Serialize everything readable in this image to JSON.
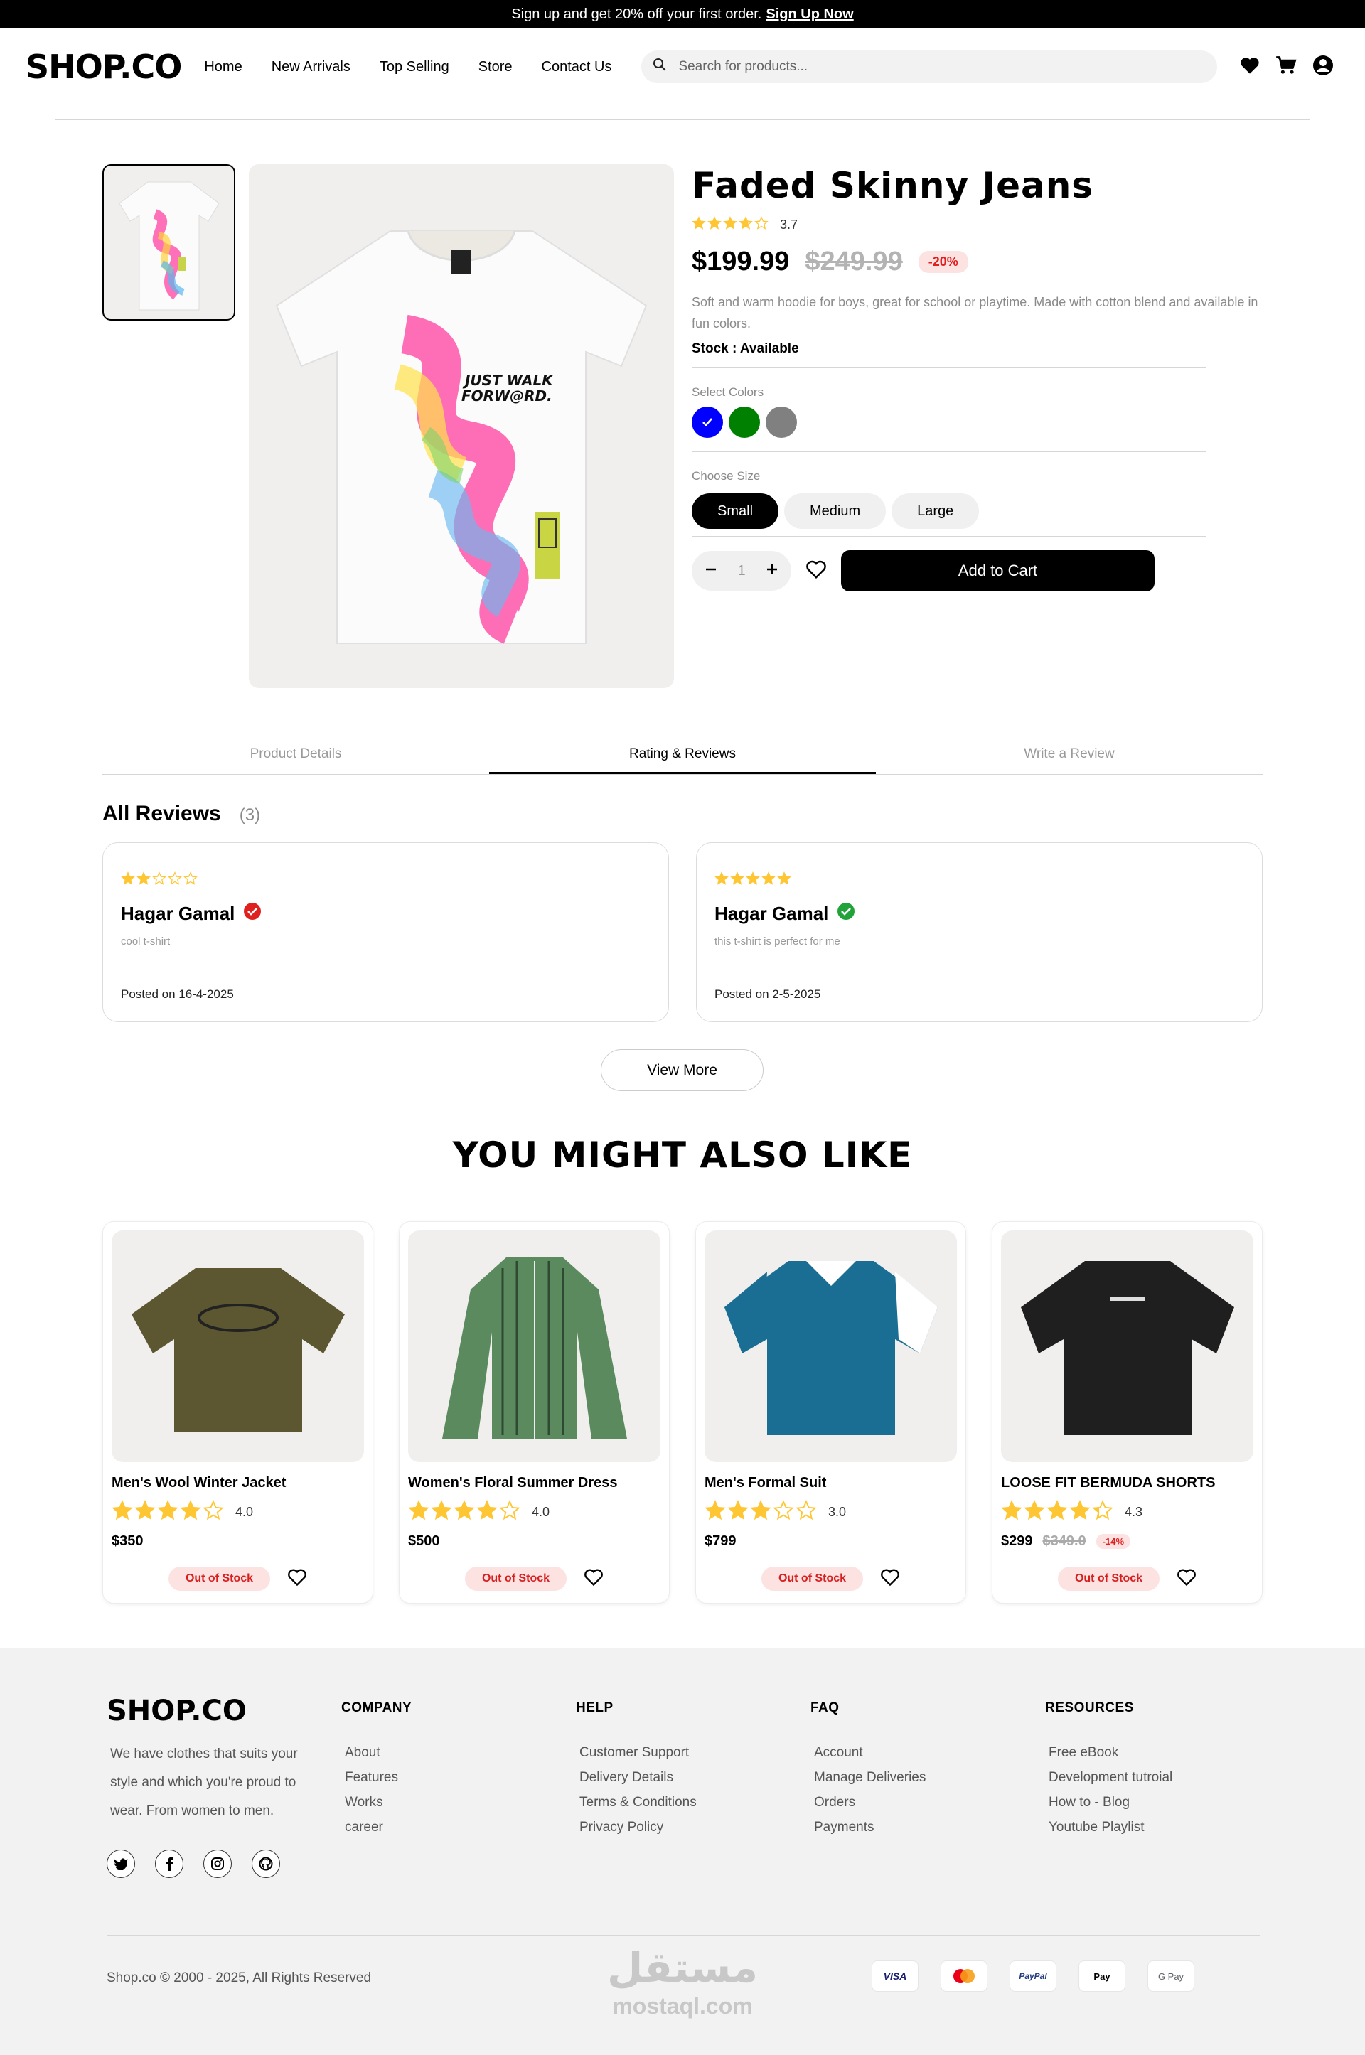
{
  "banner": {
    "text": "Sign up and get 20% off your first order.",
    "link": "Sign Up Now"
  },
  "nav": {
    "logo": "SHOP.CO",
    "links": [
      "Home",
      "New Arrivals",
      "Top Selling",
      "Store",
      "Contact Us"
    ],
    "search_placeholder": "Search for products..."
  },
  "product": {
    "title": "Faded Skinny Jeans",
    "rating": "3.7",
    "rating_value": 3.7,
    "price": "$199.99",
    "old_price": "$249.99",
    "discount": "-20%",
    "description": "Soft and warm hoodie for boys, great for school or playtime. Made with cotton blend and available in fun colors.",
    "stock": "Stock : Available",
    "colors_label": "Select Colors",
    "colors": [
      "#0000ff",
      "#008000",
      "#808080"
    ],
    "size_label": "Choose Size",
    "sizes": [
      "Small",
      "Medium",
      "Large"
    ],
    "quantity": "1",
    "add_to_cart": "Add to Cart",
    "print_text": "JUST WALK FORW@RD."
  },
  "tabs": [
    "Product Details",
    "Rating & Reviews",
    "Write a Review"
  ],
  "reviews": {
    "title": "All Reviews",
    "count": "(3)",
    "items": [
      {
        "rating": 2,
        "name": "Hagar Gamal",
        "text": "cool t-shirt",
        "date": "Posted on 16-4-2025",
        "verified_color": "#e01f1f"
      },
      {
        "rating": 5,
        "name": "Hagar Gamal",
        "text": "this t-shirt is perfect for me",
        "date": "Posted on 2-5-2025",
        "verified_color": "#22a33a"
      }
    ],
    "view_more": "View More"
  },
  "also_like": {
    "title": "YOU MIGHT ALSO LIKE",
    "items": [
      {
        "name": "Men's Wool Winter Jacket",
        "rating": "4.0",
        "rating_value": 4.0,
        "price": "$350",
        "status": "Out of Stock",
        "color": "#5c5631"
      },
      {
        "name": "Women's Floral Summer Dress",
        "rating": "4.0",
        "rating_value": 4.0,
        "price": "$500",
        "status": "Out of Stock",
        "color": "#5a8a5e"
      },
      {
        "name": "Men's Formal Suit",
        "rating": "3.0",
        "rating_value": 3.0,
        "price": "$799",
        "status": "Out of Stock",
        "color": "#1a6e93"
      },
      {
        "name": "LOOSE FIT BERMUDA SHORTS",
        "rating": "4.3",
        "rating_value": 4.3,
        "price": "$299",
        "old_price": "$349.0",
        "discount": "-14%",
        "status": "Out of Stock",
        "color": "#1f1f1f"
      }
    ]
  },
  "footer": {
    "logo": "SHOP.CO",
    "about": "We have clothes that suits your style and which you're proud to wear. From women to men.",
    "columns": [
      {
        "title": "COMPANY",
        "links": [
          "About",
          "Features",
          "Works",
          "career"
        ]
      },
      {
        "title": "HELP",
        "links": [
          "Customer Support",
          "Delivery Details",
          "Terms & Conditions",
          "Privacy Policy"
        ]
      },
      {
        "title": "FAQ",
        "links": [
          "Account",
          "Manage Deliveries",
          "Orders",
          "Payments"
        ]
      },
      {
        "title": "RESOURCES",
        "links": [
          "Free eBook",
          "Development tutroial",
          "How to - Blog",
          "Youtube Playlist"
        ]
      }
    ],
    "copyright": "Shop.co © 2000 - 2025, All Rights Reserved",
    "payments": [
      "VISA",
      "Mastercard",
      "PayPal",
      "Apple Pay",
      "G Pay"
    ],
    "watermark_ar": "مستقل",
    "watermark_en": "mostaql.com"
  },
  "colors": {
    "accent": "#000000",
    "star": "#ffc633",
    "danger": "#e01f1f",
    "danger_bg": "#fde2e2"
  }
}
